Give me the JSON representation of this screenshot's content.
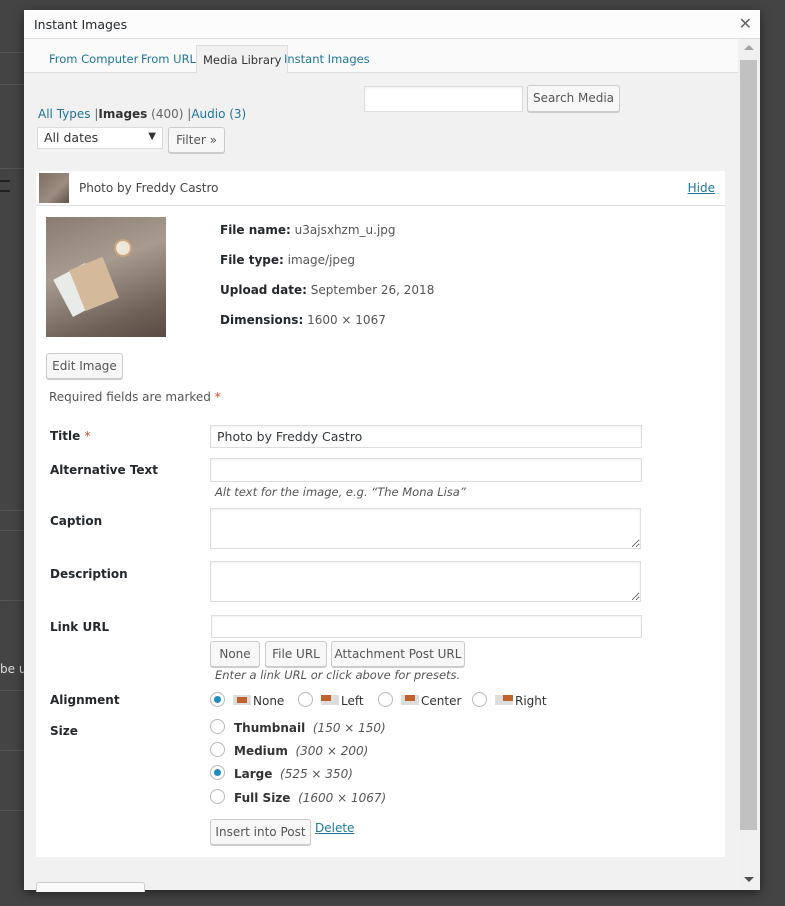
{
  "modal": {
    "title": "Instant Images",
    "close_icon": "close-icon"
  },
  "tabs": [
    {
      "label": "From Computer"
    },
    {
      "label": "From URL"
    },
    {
      "label": "Media Library",
      "active": true
    },
    {
      "label": "Instant Images"
    }
  ],
  "filters": {
    "all_types": "All Types",
    "images": "Images",
    "images_count": "(400)",
    "audio": "Audio (3)",
    "separator": "|",
    "dates_value": "All dates",
    "filter_button": "Filter »",
    "search_value": "",
    "search_button": "Search Media"
  },
  "item": {
    "title": "Photo by Freddy Castro",
    "hide": "Hide",
    "meta": [
      {
        "label": "File name:",
        "value": "u3ajsxhzm_u.jpg"
      },
      {
        "label": "File type:",
        "value": "image/jpeg"
      },
      {
        "label": "Upload date:",
        "value": "September 26, 2018"
      },
      {
        "label": "Dimensions:",
        "value": "1600 × 1067"
      }
    ],
    "edit_image": "Edit Image",
    "required_note": "Required fields are marked",
    "required_star": "*"
  },
  "form": {
    "title_label": "Title",
    "title_value": "Photo by Freddy Castro",
    "alt_label": "Alternative Text",
    "alt_value": "",
    "alt_help": "Alt text for the image, e.g. “The Mona Lisa”",
    "caption_label": "Caption",
    "caption_value": "",
    "description_label": "Description",
    "description_value": "",
    "link_label": "Link URL",
    "link_value": "",
    "link_buttons": [
      "None",
      "File URL",
      "Attachment Post URL"
    ],
    "link_help": "Enter a link URL or click above for presets.",
    "alignment_label": "Alignment",
    "alignments": [
      {
        "label": "None",
        "checked": true
      },
      {
        "label": "Left"
      },
      {
        "label": "Center"
      },
      {
        "label": "Right"
      }
    ],
    "size_label": "Size",
    "sizes": [
      {
        "label": "Thumbnail",
        "dims": "(150 × 150)"
      },
      {
        "label": "Medium",
        "dims": "(300 × 200)"
      },
      {
        "label": "Large",
        "dims": "(525 × 350)",
        "checked": true
      },
      {
        "label": "Full Size",
        "dims": "(1600 × 1067)"
      }
    ],
    "insert_button": "Insert into Post",
    "delete_link": "Delete"
  },
  "colors": {
    "link": "#21759b",
    "accent": "#1e8cbe"
  }
}
